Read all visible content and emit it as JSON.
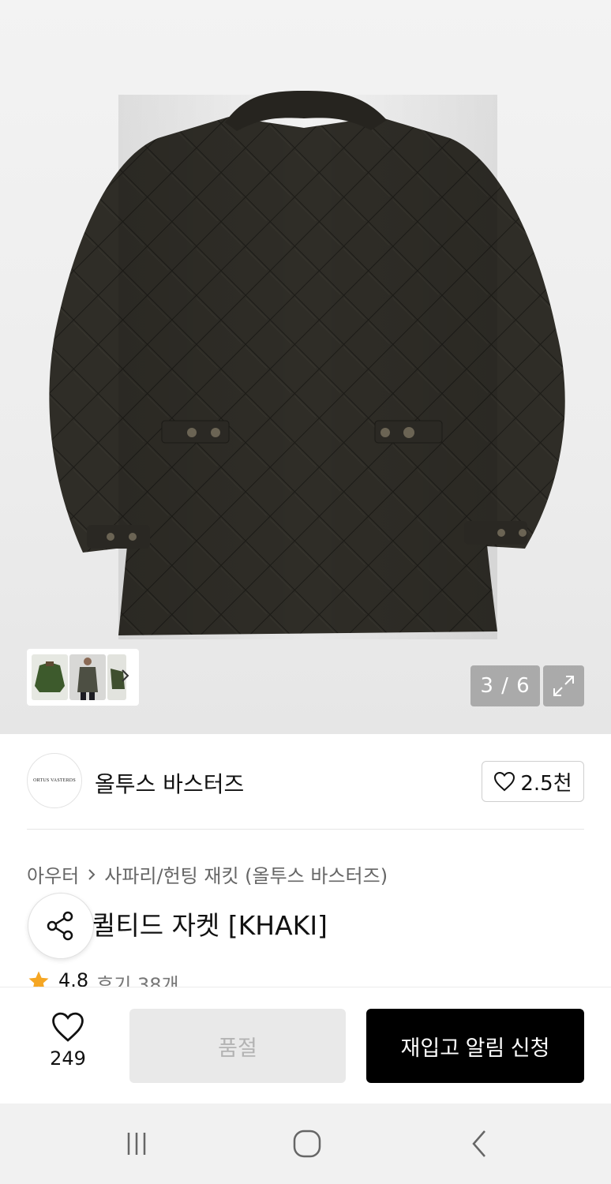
{
  "gallery": {
    "counter": "3 / 6",
    "icons": {
      "expand": "expand-icon",
      "next": "chevron-right-icon"
    }
  },
  "brand": {
    "logo_text": "ORTUS VASTERDS",
    "name": "올투스 바스터즈",
    "like_count": "2.5천"
  },
  "breadcrumb": {
    "category": "아우터",
    "subcategory": "사파리/헌팅 재킷 (올투스 바스터즈)"
  },
  "product": {
    "title": "퀼티드 자켓 [KHAKI]",
    "rating": "4.8",
    "reviews": "후기 38개"
  },
  "actions": {
    "wish_count": "249",
    "soldout_label": "품절",
    "restock_label": "재입고 알림 신청"
  },
  "colors": {
    "accent": "#000000",
    "star": "#f5a623",
    "disabled_bg": "#e9e9e9",
    "disabled_text": "#b3b3b3"
  }
}
